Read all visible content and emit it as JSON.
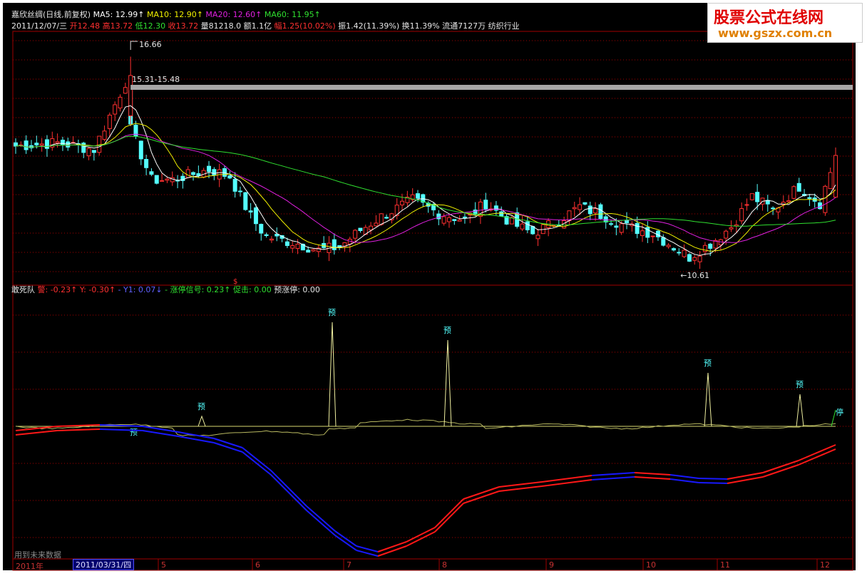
{
  "header": {
    "line1": [
      {
        "text": "嘉欣丝绸(日线,前复权)",
        "color": "#e6e6e6"
      },
      {
        "text": " MA5: 12.99↑",
        "color": "#ffffff"
      },
      {
        "text": " MA10: 12.90↑",
        "color": "#f0f000"
      },
      {
        "text": " MA20: 12.60↑",
        "color": "#e020e0"
      },
      {
        "text": " MA60: 11.95↑",
        "color": "#30e030"
      }
    ],
    "line2": [
      {
        "text": "2011/12/07/三",
        "color": "#e6e6e6"
      },
      {
        "text": " 开12.48",
        "color": "#ff3030"
      },
      {
        "text": " 高13.72",
        "color": "#ff3030"
      },
      {
        "text": " 低12.30",
        "color": "#30e030"
      },
      {
        "text": " 收13.72",
        "color": "#ff3030"
      },
      {
        "text": " 量81218.0",
        "color": "#e6e6e6"
      },
      {
        "text": " 额1.1亿",
        "color": "#e6e6e6"
      },
      {
        "text": " 幅1.25(10.02%)",
        "color": "#ff3030"
      },
      {
        "text": " 振1.42(11.39%)",
        "color": "#e6e6e6"
      },
      {
        "text": " 换11.39%",
        "color": "#e6e6e6"
      },
      {
        "text": " 流通7127万",
        "color": "#e6e6e6"
      },
      {
        "text": " 纺织行业",
        "color": "#e6e6e6"
      }
    ]
  },
  "price_annotations": {
    "high": "16.66",
    "band": "15.31-15.48",
    "low": "←10.61",
    "dollar": "$"
  },
  "indicator": {
    "items": [
      {
        "text": "敢死队 ",
        "color": "#e6e6e6"
      },
      {
        "text": "警: -0.23↑ ",
        "color": "#ff3030"
      },
      {
        "text": " Y: -0.30↑ ",
        "color": "#ff3030"
      },
      {
        "text": " - Y1: 0.07↓ ",
        "color": "#6060ff"
      },
      {
        "text": " - 涨停信号: 0.23↑ ",
        "color": "#30e030"
      },
      {
        "text": " 促击: 0.00 ",
        "color": "#30e030"
      },
      {
        "text": " 预涨停: 0.00",
        "color": "#e6e6e6"
      }
    ],
    "signal_label": "预",
    "limit_label": "停"
  },
  "logo": {
    "title": "股票公式在线网",
    "url": "www.gszx.com.cn"
  },
  "footer": {
    "note": "用到未来数据",
    "year": "2011年",
    "current_date": "2011/03/31/四",
    "months": [
      "5",
      "6",
      "7",
      "8",
      "9",
      "10",
      "11",
      "12"
    ]
  },
  "colors": {
    "up": "#ff3030",
    "down": "#54ffff",
    "ma5": "#ffffff",
    "ma10": "#f0f000",
    "ma20": "#e020e0",
    "ma60": "#30e030",
    "grid": "#a00000",
    "curve_blue": "#1818ff",
    "curve_red": "#ff1818"
  }
}
